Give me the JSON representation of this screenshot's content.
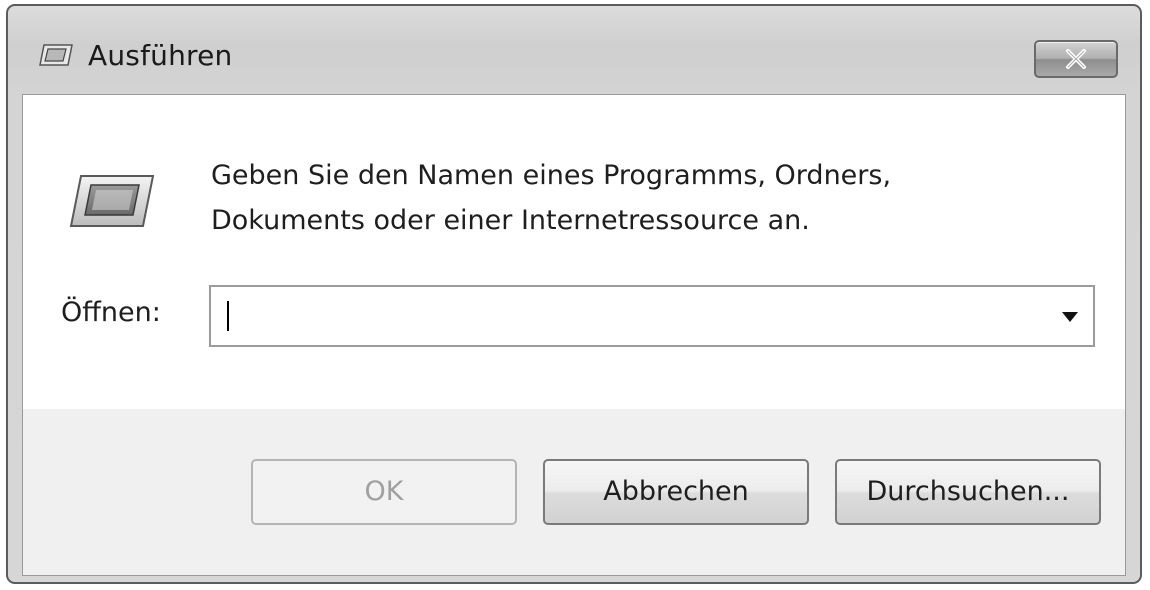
{
  "window": {
    "title": "Ausführen",
    "close_label": "×"
  },
  "dialog": {
    "description_line1": "Geben Sie den Namen eines Programms, Ordners,",
    "description_line2": "Dokuments oder einer Internetressource an.",
    "open_label": "Öffnen:",
    "open_value": ""
  },
  "buttons": {
    "ok": "OK",
    "cancel": "Abbrechen",
    "browse": "Durchsuchen..."
  },
  "icons": {
    "title": "run-icon",
    "main": "run-icon",
    "close": "close-icon",
    "dropdown": "dropdown-arrow-icon"
  },
  "colors": {
    "window_frame": "#d4d4d4",
    "client_upper": "#ffffff",
    "client_lower": "#f0f0f0",
    "disabled_text": "#a0a0a0"
  }
}
